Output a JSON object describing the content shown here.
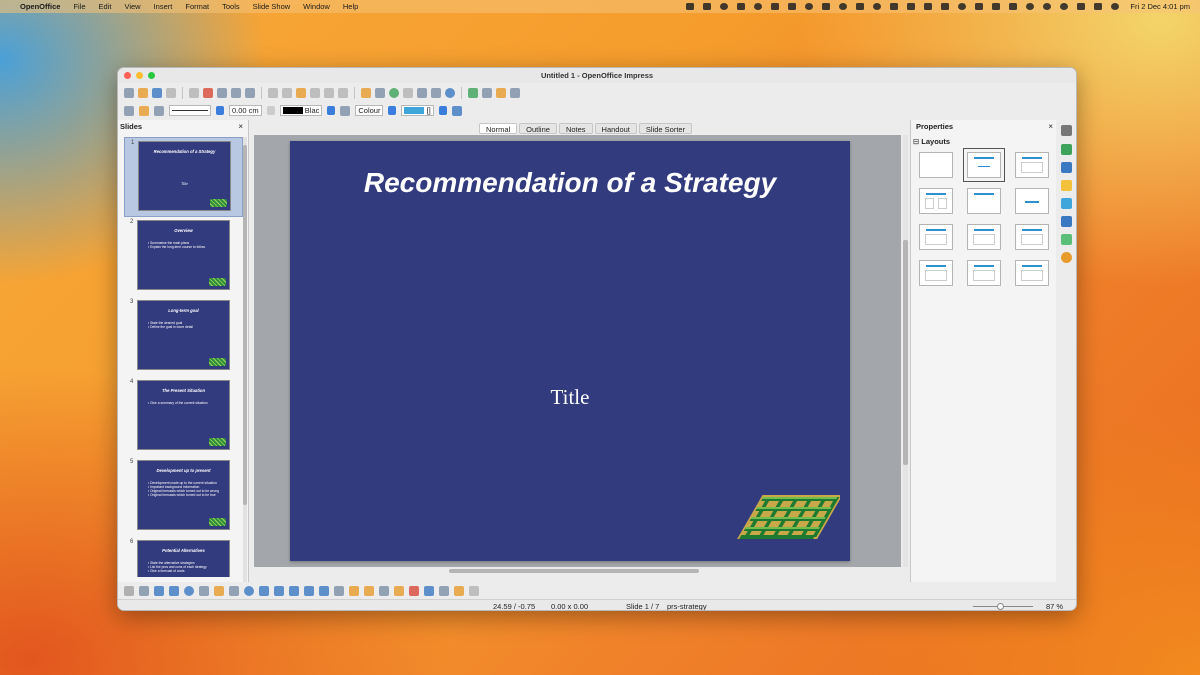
{
  "menubar": {
    "app": "OpenOffice",
    "items": [
      "File",
      "Edit",
      "View",
      "Insert",
      "Format",
      "Tools",
      "Slide Show",
      "Window",
      "Help"
    ],
    "clock": "Fri 2 Dec  4:01 pm"
  },
  "window": {
    "title": "Untitled 1 - OpenOffice Impress"
  },
  "line_toolbar": {
    "width_value": "0.00 cm",
    "color_value": "Blac",
    "fill_mode": "Colour",
    "fill_value": "[]"
  },
  "slides_pane": {
    "title": "Slides",
    "close": "×",
    "slides": [
      {
        "num": "1",
        "title": "Recommendation of a Strategy",
        "subtitle": "Title",
        "bullets": ""
      },
      {
        "num": "2",
        "title": "Overview",
        "subtitle": "",
        "bullets": "• Summarise the main plans\n• Explain the long-term course to follow"
      },
      {
        "num": "3",
        "title": "Long-term goal",
        "subtitle": "",
        "bullets": "• State the desired goal\n• Define the goal in more detail"
      },
      {
        "num": "4",
        "title": "The Present Situation",
        "subtitle": "",
        "bullets": "• Give a summary of the current situation"
      },
      {
        "num": "5",
        "title": "Development up to present",
        "subtitle": "",
        "bullets": "• Development made up to the current situation\n• Important background information\n• Original forecasts which turned out to be wrong\n• Original forecasts which turned out to be true"
      },
      {
        "num": "6",
        "title": "Potential Alternatives",
        "subtitle": "",
        "bullets": "• State the alternative strategies\n• List the pros and cons of each strategy\n• Give a forecast of costs"
      }
    ]
  },
  "view_tabs": [
    "Normal",
    "Outline",
    "Notes",
    "Handout",
    "Slide Sorter"
  ],
  "active_view_tab": "Normal",
  "slide": {
    "title": "Recommendation of a Strategy",
    "subtitle": "Title",
    "background": "#333b7f"
  },
  "properties": {
    "title": "Properties",
    "close": "×",
    "section": "Layouts",
    "section_chevron": "⊟"
  },
  "statusbar": {
    "position": "24.59 / -0.75",
    "size": "0.00 x 0.00",
    "slide": "Slide 1 / 7",
    "master": "prs-strategy",
    "zoom": "87 %"
  },
  "colors": {
    "accent": "#3b7ddd",
    "slide_bg": "#333b7f"
  }
}
